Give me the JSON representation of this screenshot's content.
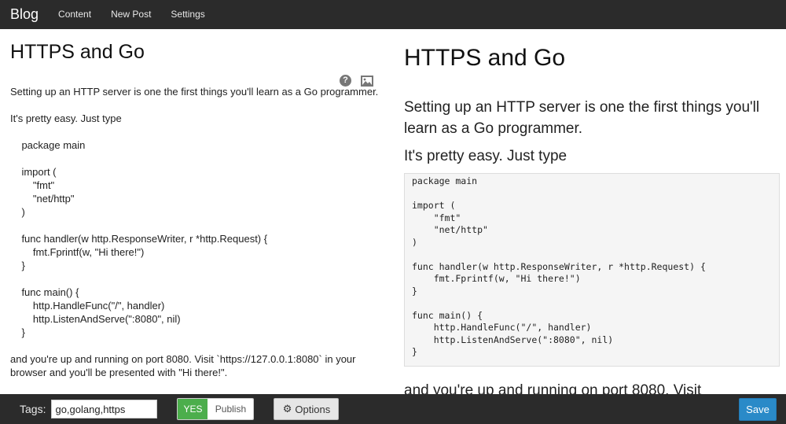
{
  "navbar": {
    "brand": "Blog",
    "links": [
      "Content",
      "New Post",
      "Settings"
    ]
  },
  "editor": {
    "title": "HTTPS and Go",
    "paragraph1": "Setting up an HTTP server is one the first things you'll learn as a Go programmer.",
    "paragraph2": "It's pretty easy. Just type",
    "code": "    package main\n\n    import (\n        \"fmt\"\n        \"net/http\"\n    )\n\n    func handler(w http.ResponseWriter, r *http.Request) {\n        fmt.Fprintf(w, \"Hi there!\")\n    }\n\n    func main() {\n        http.HandleFunc(\"/\", handler)\n        http.ListenAndServe(\":8080\", nil)\n    }",
    "paragraph3": "and you're up and running on port 8080. Visit `https://127.0.0.1:8080` in your browser and you'll be presented with \"Hi there!\".",
    "help_icon_glyph": "?"
  },
  "preview": {
    "title": "HTTPS and Go",
    "paragraph1": "Setting up an HTTP server is one the first things you'll learn as a Go programmer.",
    "paragraph2": "It's pretty easy. Just type",
    "code": "package main\n\nimport (\n    \"fmt\"\n    \"net/http\"\n)\n\nfunc handler(w http.ResponseWriter, r *http.Request) {\n    fmt.Fprintf(w, \"Hi there!\")\n}\n\nfunc main() {\n    http.HandleFunc(\"/\", handler)\n    http.ListenAndServe(\":8080\", nil)\n}",
    "paragraph3": "and you're up and running on port 8080. Visit"
  },
  "toolbar": {
    "tags_label": "Tags:",
    "tags_value": "go,golang,https",
    "toggle_yes": "YES",
    "toggle_publish": "Publish",
    "options_label": "Options",
    "gear_glyph": "⚙",
    "save_label": "Save"
  },
  "colors": {
    "navbar_bg": "#2b2b2b",
    "yes_green": "#4cae4c",
    "save_blue": "#2a8ac8"
  }
}
